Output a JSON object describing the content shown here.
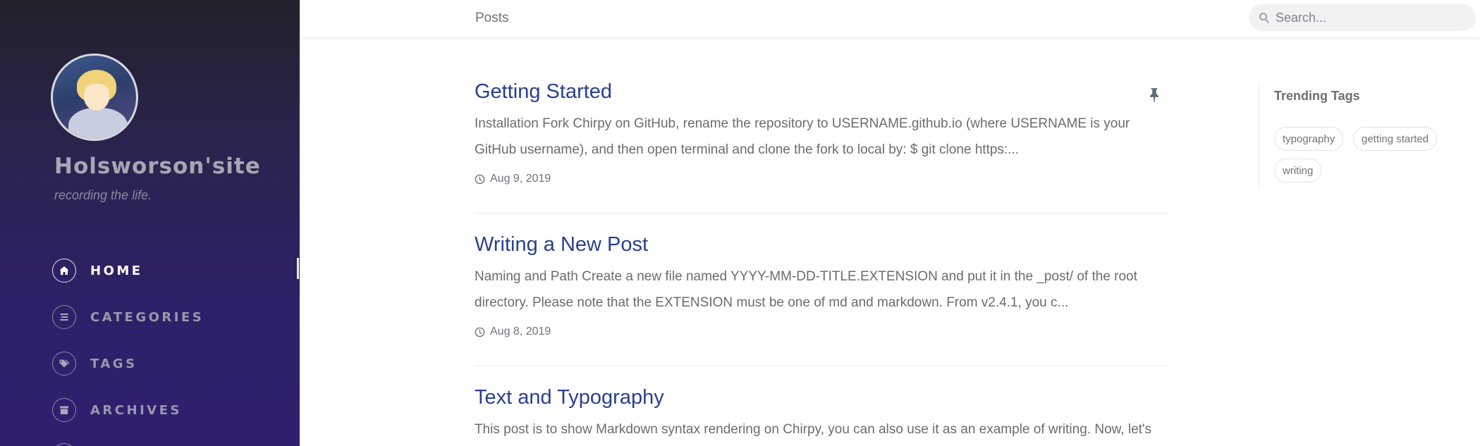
{
  "sidebar": {
    "site_title": "Holsworson'site",
    "site_subtitle": "recording the life.",
    "nav": [
      {
        "label": "HOME",
        "icon": "home-icon",
        "active": true
      },
      {
        "label": "CATEGORIES",
        "icon": "stream-icon",
        "active": false
      },
      {
        "label": "TAGS",
        "icon": "tags-icon",
        "active": false
      },
      {
        "label": "ARCHIVES",
        "icon": "archive-icon",
        "active": false
      }
    ]
  },
  "topbar": {
    "breadcrumb": "Posts",
    "search_placeholder": "Search..."
  },
  "posts": [
    {
      "title": "Getting Started",
      "excerpt": "Installation Fork Chirpy on GitHub, rename the repository to USERNAME.github.io (where USERNAME is your GitHub username), and then open terminal and clone the fork to local by: $ git clone https:...",
      "date": "Aug 9, 2019",
      "pinned": true
    },
    {
      "title": "Writing a New Post",
      "excerpt": "Naming and Path Create a new file named YYYY-MM-DD-TITLE.EXTENSION and put it in the _post/ of the root directory. Please note that the EXTENSION must be one of md and markdown. From v2.4.1, you c...",
      "date": "Aug 8, 2019",
      "pinned": false
    },
    {
      "title": "Text and Typography",
      "excerpt": "This post is to show Markdown syntax rendering on Chirpy, you can also use it as an example of writing. Now, let's",
      "date": "",
      "pinned": false
    }
  ],
  "trending": {
    "title": "Trending Tags",
    "tags": [
      "typography",
      "getting started",
      "writing"
    ]
  },
  "colors": {
    "link": "#2a408e",
    "sidebar_top": "#23212b",
    "sidebar_bottom": "#301f6e"
  }
}
